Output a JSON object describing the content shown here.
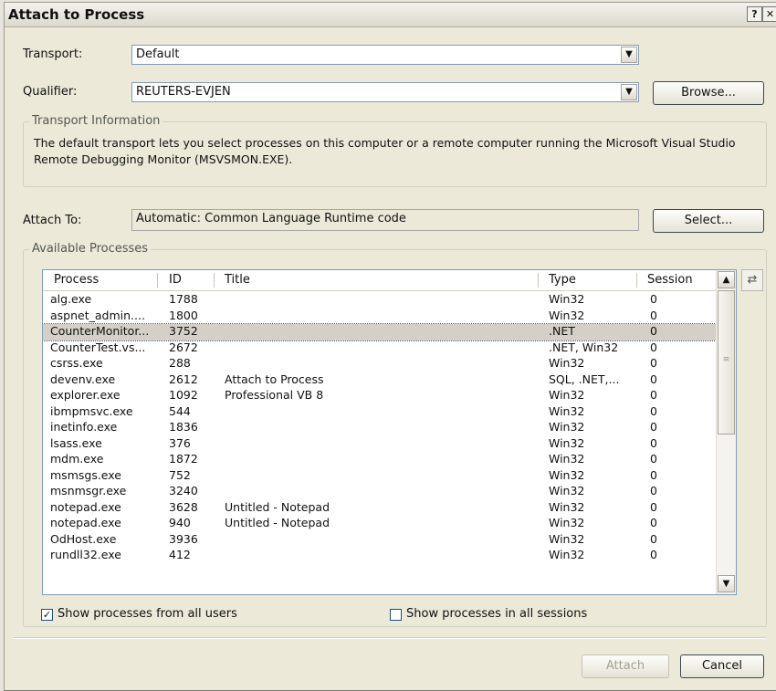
{
  "window": {
    "title": "Attach to Process",
    "help_icon": "?",
    "close_icon": "✕"
  },
  "transport": {
    "label": "Transport:",
    "value": "Default"
  },
  "qualifier": {
    "label": "Qualifier:",
    "value": "REUTERS-EVJEN",
    "browse_label": "Browse..."
  },
  "transport_info": {
    "group_title": "Transport Information",
    "text": "The default transport lets you select processes on this computer or a remote computer running the Microsoft Visual Studio Remote Debugging Monitor (MSVSMON.EXE)."
  },
  "attach_to": {
    "label": "Attach To:",
    "value": "Automatic: Common Language Runtime code",
    "select_label": "Select..."
  },
  "processes": {
    "group_title": "Available Processes",
    "columns": [
      "Process",
      "ID",
      "Title",
      "Type",
      "Session"
    ],
    "selected_index": 2,
    "rows": [
      [
        "alg.exe",
        "1788",
        "",
        "Win32",
        "0"
      ],
      [
        "aspnet_admin....",
        "1800",
        "",
        "Win32",
        "0"
      ],
      [
        "CounterMonitor...",
        "3752",
        "",
        ".NET",
        "0"
      ],
      [
        "CounterTest.vs...",
        "2672",
        "",
        ".NET, Win32",
        "0"
      ],
      [
        "csrss.exe",
        "288",
        "",
        "Win32",
        "0"
      ],
      [
        "devenv.exe",
        "2612",
        "Attach to Process",
        "SQL, .NET,...",
        "0"
      ],
      [
        "explorer.exe",
        "1092",
        "Professional VB 8",
        "Win32",
        "0"
      ],
      [
        "ibmpmsvc.exe",
        "544",
        "",
        "Win32",
        "0"
      ],
      [
        "inetinfo.exe",
        "1836",
        "",
        "Win32",
        "0"
      ],
      [
        "lsass.exe",
        "376",
        "",
        "Win32",
        "0"
      ],
      [
        "mdm.exe",
        "1872",
        "",
        "Win32",
        "0"
      ],
      [
        "msmsgs.exe",
        "752",
        "",
        "Win32",
        "0"
      ],
      [
        "msnmsgr.exe",
        "3240",
        "",
        "Win32",
        "0"
      ],
      [
        "notepad.exe",
        "3628",
        "Untitled - Notepad",
        "Win32",
        "0"
      ],
      [
        "notepad.exe",
        "940",
        "Untitled - Notepad",
        "Win32",
        "0"
      ],
      [
        "OdHost.exe",
        "3936",
        "",
        "Win32",
        "0"
      ],
      [
        "rundll32.exe",
        "412",
        "",
        "Win32",
        "0"
      ]
    ]
  },
  "options": {
    "show_all_users_label": "Show processes from all users",
    "show_all_users_checked": true,
    "show_all_sessions_label": "Show processes in all sessions",
    "show_all_sessions_checked": false
  },
  "footer": {
    "attach_label": "Attach",
    "cancel_label": "Cancel"
  }
}
